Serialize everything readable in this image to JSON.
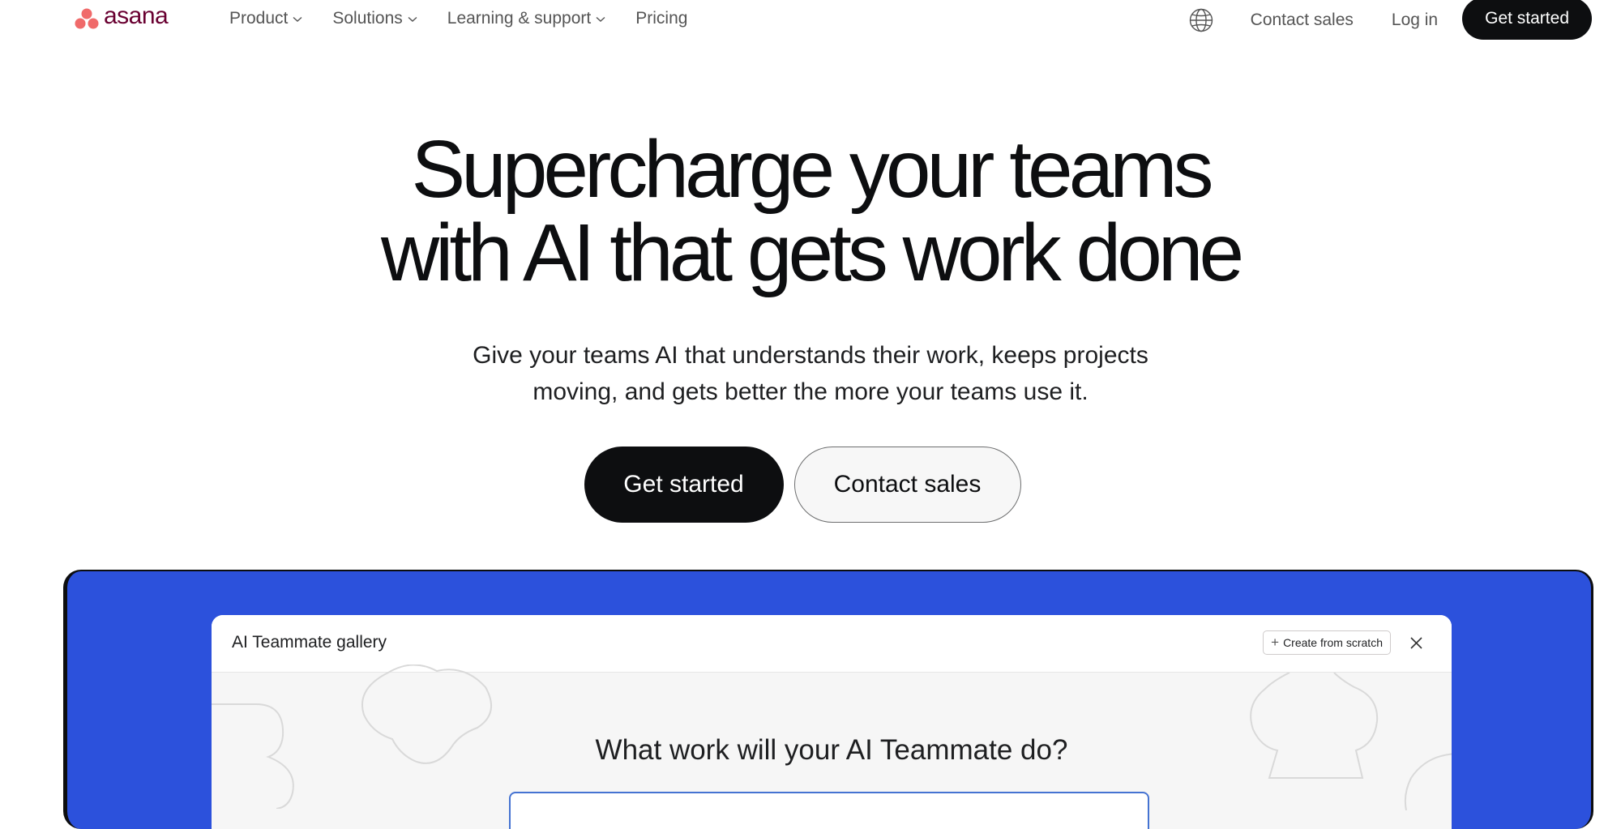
{
  "brand": {
    "name": "asana",
    "colors": {
      "dot": "#f06a6a",
      "wordmark": "#690031"
    }
  },
  "nav": {
    "links": [
      {
        "label": "Product",
        "has_dropdown": true
      },
      {
        "label": "Solutions",
        "has_dropdown": true
      },
      {
        "label": "Learning & support",
        "has_dropdown": true
      },
      {
        "label": "Pricing",
        "has_dropdown": false
      }
    ],
    "language_icon": "globe-icon",
    "contact_sales": "Contact sales",
    "log_in": "Log in",
    "get_started": "Get started"
  },
  "hero": {
    "title_line1": "Supercharge your teams",
    "title_line2": "with AI that gets work done",
    "subtitle_line1": "Give your teams AI that understands their work, keeps projects",
    "subtitle_line2": "moving, and gets better the more your teams use it.",
    "primary_cta": "Get started",
    "secondary_cta": "Contact sales"
  },
  "showcase": {
    "background_color": "#2c51dc",
    "modal": {
      "title": "AI Teammate gallery",
      "create_button": "Create from scratch",
      "create_icon": "plus-icon",
      "close_icon": "close-icon",
      "question": "What work will your AI Teammate do?",
      "input_value": ""
    }
  }
}
